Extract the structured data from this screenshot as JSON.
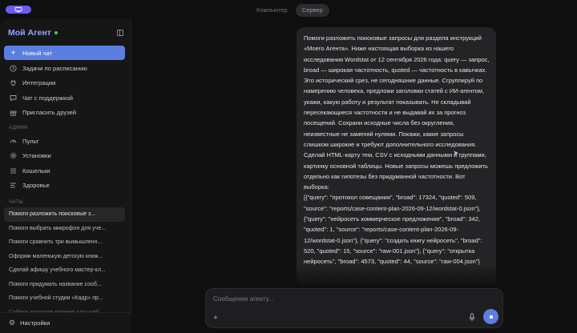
{
  "topbar": {
    "modes": [
      "Компьютер",
      "Сервер"
    ],
    "active_mode": "Сервер",
    "accent": "#6d5cf0"
  },
  "sidebar": {
    "brand": "Мой Агент",
    "status_color": "#49c46a",
    "nav": [
      {
        "label": "Новый чат",
        "icon": "plus-icon"
      },
      {
        "label": "Задачи по расписанию",
        "icon": "clock-icon"
      },
      {
        "label": "Интеграции",
        "icon": "plug-icon"
      },
      {
        "label": "Чат с поддержкой",
        "icon": "chat-icon"
      },
      {
        "label": "Пригласить друзей",
        "icon": "gift-icon"
      }
    ],
    "admin_label": "АДМИН",
    "admin": [
      {
        "label": "Пульт",
        "icon": "dashboard-icon"
      },
      {
        "label": "Установки",
        "icon": "settings-icon"
      },
      {
        "label": "Кошельки",
        "icon": "wallet-icon"
      },
      {
        "label": "Здоровье",
        "icon": "health-icon"
      }
    ],
    "chats_label": "ЧАТЫ",
    "chats": [
      "Помоги разложить поисковые з...",
      "Помоги выбрать микрофон для уче...",
      "Помоги сравнить три вымышленн...",
      "Оформи маленькую детскую книж...",
      "Сделай афишу учебного мастер-кл...",
      "Помоги придумать название сооб...",
      "Помоги учебной студии «Кадр» пр...",
      "Собери короткое резюме для учеб..."
    ],
    "settings_label": "Настройки",
    "accent": "#5b7fe0"
  },
  "message": {
    "text": "Помоги разложить поисковые запросы для раздела инструкций «Моего Агента». Ниже настоящая выборка из нашего исследования Wordstat от 12 сентября 2026 года: query — запрос, broad — широкая частотность, quoted — частотность в кавычках. Это исторический срез, не сегодняшние данные. Сгруппируй по намерению человека, предложи заголовки статей с ИИ-агентом, укажи, какую работу и результат показывать. Не складывай пересекающиеся частотности и не выдавай их за прогноз посещений. Сохрани исходные числа без округления, неизвестные не заменяй нулями. Покажи, какие запросы слишком широкие и требуют дополнительного исследования. Сделай HTML-карту тем, CSV с исходными данными и группами, картинку основной таблицы. Новые запросы можешь предложить отдельно как гипотезы без придуманной частотности. Вот выборка:\n[{\"query\": \"протокол совещания\", \"broad\": 17324, \"quoted\": 509, \"source\": \"reports/case-content-plan-2026-09-12/wordstat-0.json\"}, {\"query\": \"нейросеть коммерческое предложение\", \"broad\": 342, \"quoted\": 1, \"source\": \"reports/case-content-plan-2026-09-12/wordstat-0.json\"}, {\"query\": \"создать книгу нейросеть\", \"broad\": 520, \"quoted\": 15, \"source\": \"raw-001.json\"}, {\"query\": \"открытка нейросеть\", \"broad\": 4573, \"quoted\": 44, \"source\": \"raw-004.json\"}"
  },
  "composer": {
    "placeholder": "Сообщение агенту..."
  }
}
